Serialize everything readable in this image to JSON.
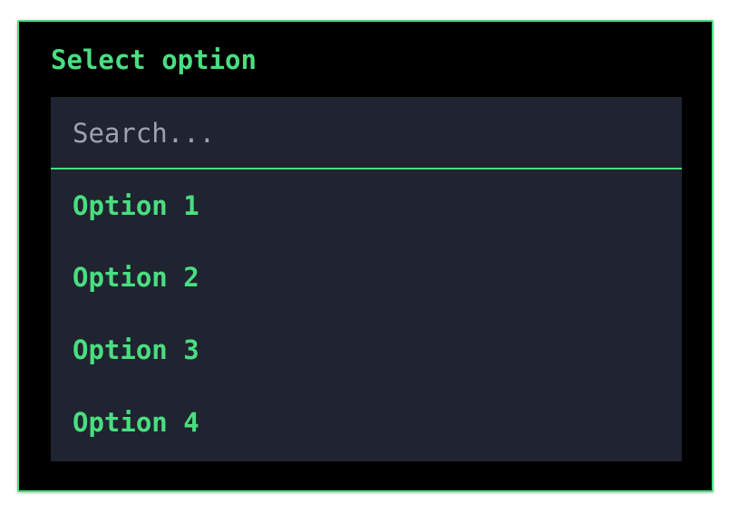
{
  "dialog": {
    "title": "Select option"
  },
  "search": {
    "placeholder": "Search...",
    "value": ""
  },
  "options": [
    {
      "label": "Option 1"
    },
    {
      "label": "Option 2"
    },
    {
      "label": "Option 3"
    },
    {
      "label": "Option 4"
    }
  ],
  "colors": {
    "accent": "#4ade80",
    "background": "#000000",
    "panel": "#1f2430",
    "placeholder": "#9ca3af"
  }
}
